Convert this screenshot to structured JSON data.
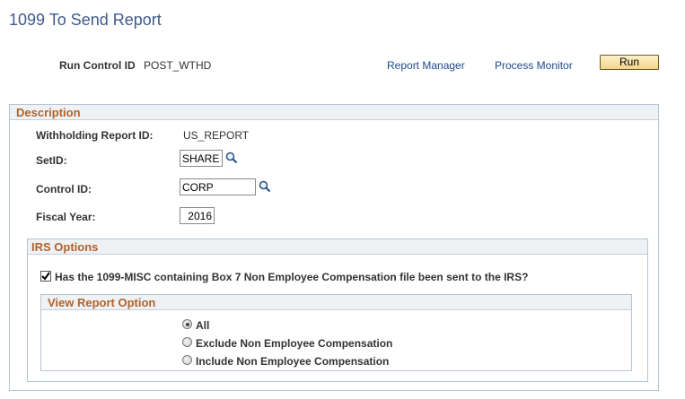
{
  "page": {
    "title": "1099 To Send Report"
  },
  "run_control": {
    "label": "Run Control ID",
    "value": "POST_WTHD"
  },
  "links": {
    "report_manager": "Report Manager",
    "process_monitor": "Process Monitor"
  },
  "toolbar": {
    "run_label": "Run"
  },
  "description": {
    "title": "Description",
    "withholding_report_label": "Withholding Report ID:",
    "withholding_report_value": "US_REPORT",
    "setid_label": "SetID:",
    "setid_value": "SHARE",
    "control_id_label": "Control ID:",
    "control_id_value": "CORP",
    "fiscal_year_label": "Fiscal Year:",
    "fiscal_year_value": "2016"
  },
  "irs_options": {
    "title": "IRS Options",
    "sent_checkbox_label": "Has the 1099-MISC containing Box 7 Non Employee Compensation file been sent to the IRS?",
    "sent_checked": true
  },
  "view_report_option": {
    "title": "View Report Option",
    "options": [
      {
        "label": "All",
        "selected": true
      },
      {
        "label": "Exclude Non Employee Compensation",
        "selected": false
      },
      {
        "label": "Include Non Employee Compensation",
        "selected": false
      }
    ]
  },
  "colors": {
    "title_blue": "#3f5a8c",
    "link_blue": "#1d4a8c",
    "group_title_orange": "#b0622a",
    "button_gold": "#f3d58a"
  }
}
